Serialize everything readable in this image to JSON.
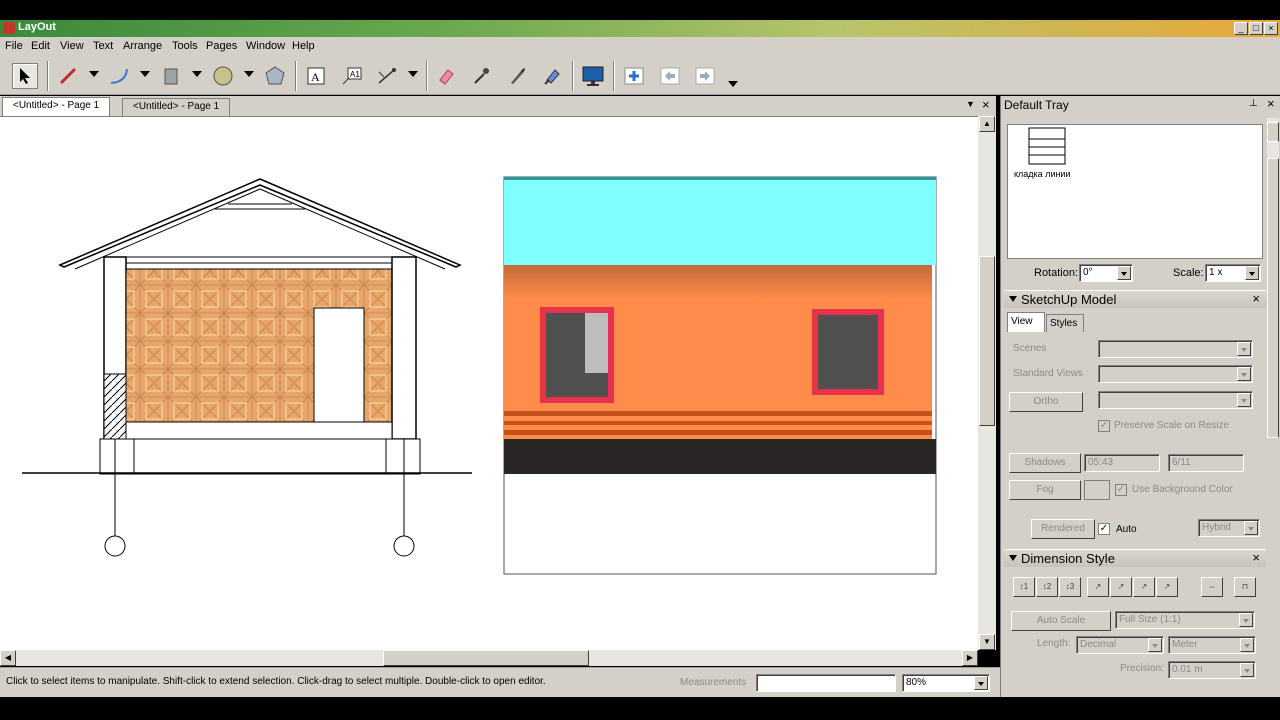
{
  "app": {
    "title": "LayOut"
  },
  "menu": [
    "File",
    "Edit",
    "View",
    "Text",
    "Arrange",
    "Tools",
    "Pages",
    "Window",
    "Help"
  ],
  "tabs": [
    "<Untitled> - Page 1",
    "<Untitled> - Page 1"
  ],
  "tray": {
    "title": "Default Tray",
    "scrapbook": {
      "item_label": "кладка линии"
    },
    "rotation": {
      "label": "Rotation:",
      "value": "0°"
    },
    "scale": {
      "label": "Scale:",
      "value": "1 x"
    },
    "sketchup": {
      "title": "SketchUp Model",
      "tab_view": "View",
      "tab_styles": "Styles",
      "scenes_label": "Scenes",
      "standard_views_label": "Standard Views",
      "ortho": "Ortho",
      "preserve_scale": "Preserve Scale on Resize",
      "shadows": "Shadows",
      "shadow_time": "05:43",
      "shadow_date": "6/11",
      "fog": "Fog",
      "use_bg": "Use Background Color",
      "rendered": "Rendered",
      "auto": "Auto",
      "hybrid": "Hybrid"
    },
    "dimension": {
      "title": "Dimension Style",
      "auto_scale": "Auto Scale",
      "full_size": "Full Size (1:1)",
      "length_label": "Length:",
      "length_format": "Decimal",
      "length_unit": "Meter",
      "precision_label": "Precision:",
      "precision_value": "0.01 m"
    }
  },
  "status": {
    "hint": "Click to select items to manipulate. Shift-click to extend selection. Click-drag to select multiple. Double-click to open editor.",
    "measurements_label": "Measurements",
    "measurements_value": "",
    "zoom": "80%"
  },
  "colors": {
    "roof": "#80ffff",
    "wall": "#ff8c4a",
    "window_frame": "#e8324a",
    "base": "#2b2626"
  },
  "icons": [
    "select-arrow-icon",
    "line-icon",
    "arc-icon",
    "rectangle-icon",
    "circle-icon",
    "polygon-icon",
    "text-icon",
    "label-icon",
    "dimension-icon",
    "eraser-icon",
    "style-picker-icon",
    "split-icon",
    "join-icon",
    "presentation-icon",
    "add-page-icon",
    "previous-page-icon",
    "next-page-icon"
  ]
}
